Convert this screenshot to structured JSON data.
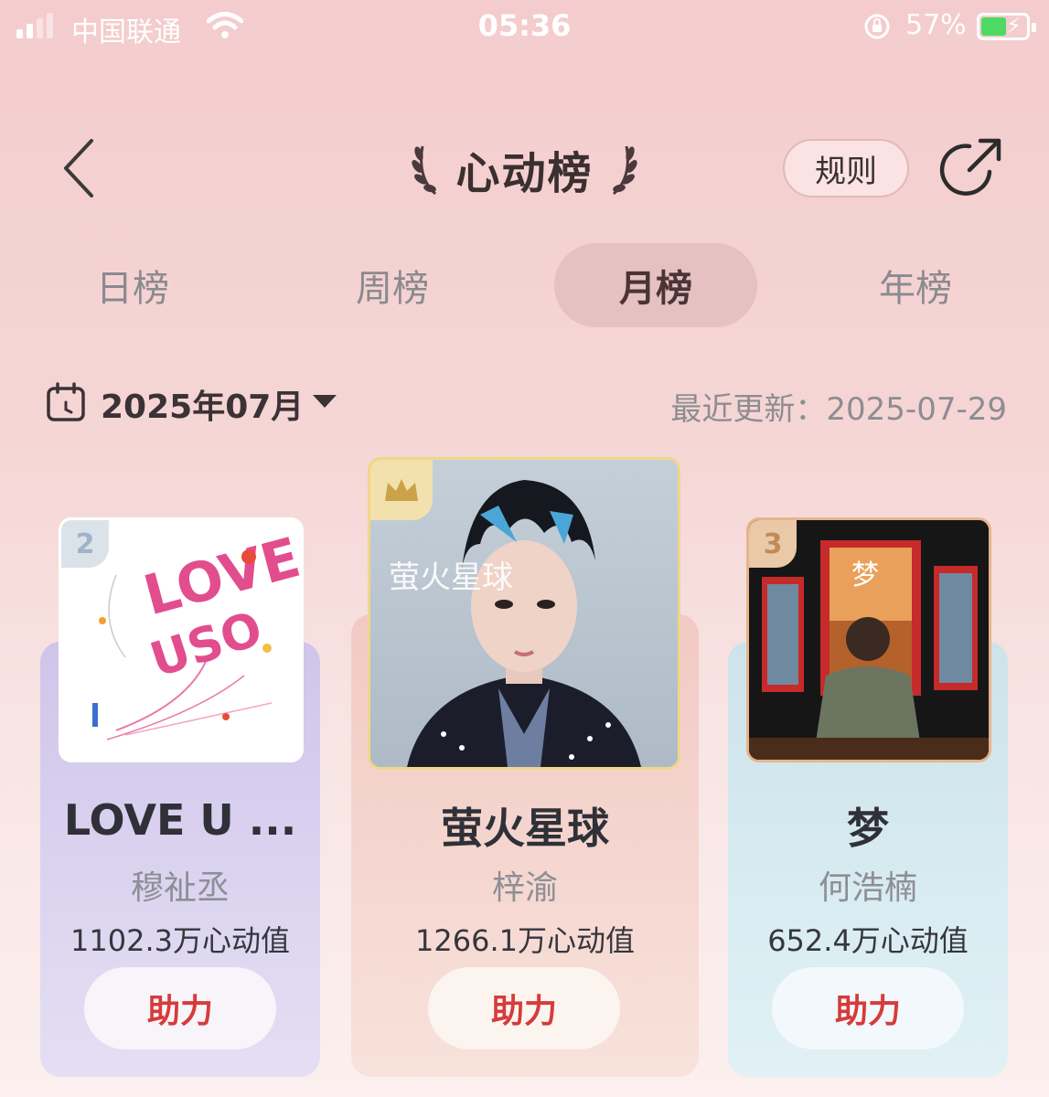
{
  "status_bar": {
    "carrier": "中国联通",
    "time": "05:36",
    "battery_percent": "57%",
    "battery_level": 0.57,
    "wifi": "wifi-icon",
    "charging": "bolt-icon"
  },
  "header": {
    "title": "心动榜",
    "rules_label": "规则",
    "back_icon": "chevron-left-icon",
    "share_icon": "share-icon"
  },
  "tabs": [
    {
      "label": "日榜",
      "active": false
    },
    {
      "label": "周榜",
      "active": false
    },
    {
      "label": "月榜",
      "active": true
    },
    {
      "label": "年榜",
      "active": false
    }
  ],
  "date_selector": {
    "value": "2025年07月",
    "updated_label": "最近更新：",
    "updated_value": "2025-07-29"
  },
  "ranking": [
    {
      "rank": "2",
      "title": "LOVE U ...",
      "artist": "穆祉丞",
      "score": "1102.3万心动值",
      "boost_label": "助力"
    },
    {
      "rank": "1",
      "title": "萤火星球",
      "artist": "梓渝",
      "score": "1266.1万心动值",
      "boost_label": "助力"
    },
    {
      "rank": "3",
      "title": "梦",
      "artist": "何浩楠",
      "score": "652.4万心动值",
      "boost_label": "助力"
    }
  ],
  "covers": {
    "cover_2_text_a": "LOVE",
    "cover_2_text_b": "USO",
    "cover_1_text": "萤火星球",
    "cover_3_text": "梦"
  },
  "colors": {
    "accent_red": "#d63b3b",
    "rank1_gold": "#f0d68a",
    "rank3_bronze": "#e7b38c"
  }
}
